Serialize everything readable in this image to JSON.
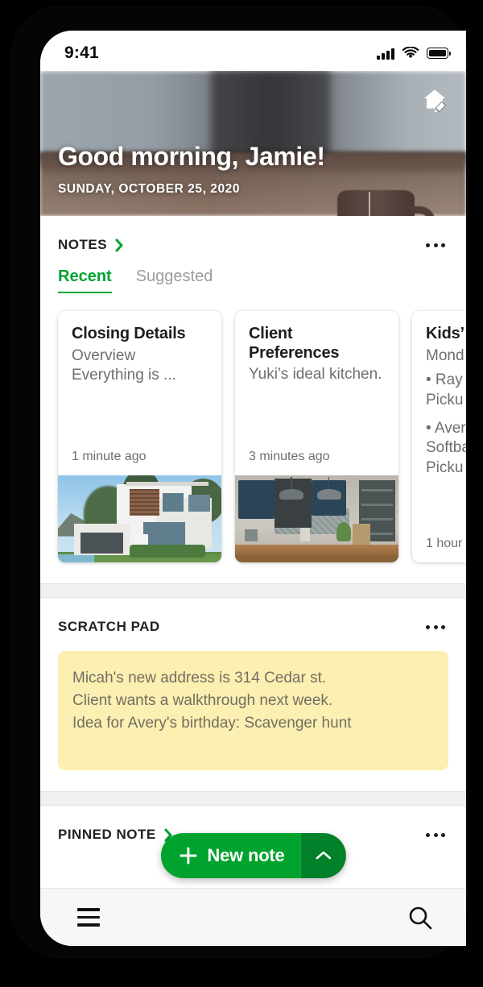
{
  "status_bar": {
    "time": "9:41",
    "signal_icon": "signal-bars-icon",
    "wifi_icon": "wifi-icon",
    "battery_icon": "battery-icon"
  },
  "hero": {
    "greeting": "Good morning, Jamie!",
    "date": "SUNDAY, OCTOBER 25, 2020",
    "action_icon": "home-edit-icon"
  },
  "notes_section": {
    "title": "NOTES",
    "chevron_icon": "chevron-right-icon",
    "overflow_icon": "more-options-icon",
    "tabs": [
      {
        "label": "Recent",
        "active": true
      },
      {
        "label": "Suggested",
        "active": false
      }
    ],
    "cards": [
      {
        "title": "Closing Details",
        "subtitle": "Overview",
        "line": "Everything is ...",
        "time": "1 minute ago",
        "image": "modern-house-photo"
      },
      {
        "title": "Client Preferences",
        "subtitle": "Yuki’s ideal kitchen.",
        "line": "",
        "time": "3 minutes ago",
        "image": "blue-kitchen-photo"
      },
      {
        "title": "Kids’",
        "subtitle": "Mond",
        "bullet1": "• Ray -",
        "bullet1b": "Picku",
        "bullet2": "• Aver",
        "bullet2b": "Softba",
        "bullet2c": "Picku",
        "time": "1 hour",
        "image": "none"
      }
    ]
  },
  "scratch_pad": {
    "title": "SCRATCH PAD",
    "overflow_icon": "more-options-icon",
    "lines": [
      "Micah's new address is 314 Cedar st.",
      "Client wants a walkthrough next week.",
      "Idea for Avery's birthday: Scavenger hunt"
    ]
  },
  "pinned_note": {
    "title": "PINNED NOTE",
    "chevron_icon": "chevron-right-icon",
    "overflow_icon": "more-options-icon"
  },
  "fab": {
    "label": "New note",
    "plus_icon": "plus-icon",
    "caret_icon": "chevron-up-icon"
  },
  "bottom_bar": {
    "menu_icon": "hamburger-menu-icon",
    "search_icon": "search-icon"
  },
  "colors": {
    "accent": "#00a32e",
    "accent_dark": "#02802a",
    "scratch_bg": "#fbefb1",
    "divider": "#f0f0f0"
  }
}
